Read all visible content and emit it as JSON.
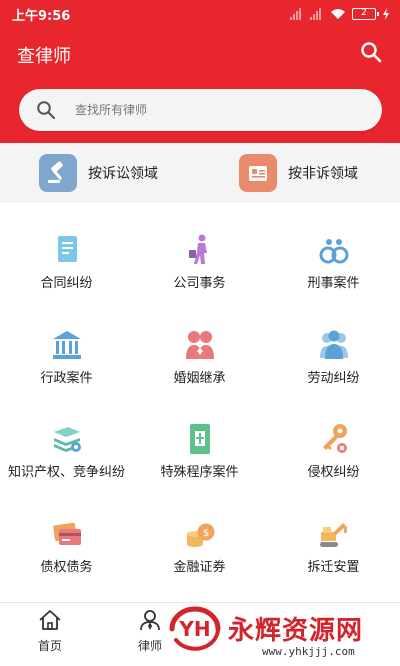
{
  "status_bar": {
    "time": "上午9:56",
    "battery": "2"
  },
  "header": {
    "title": "查律师"
  },
  "search": {
    "placeholder": "查找所有律师"
  },
  "domains": [
    {
      "label": "按诉讼领域",
      "icon": "gavel-icon"
    },
    {
      "label": "按非诉领域",
      "icon": "document-icon"
    }
  ],
  "categories": [
    {
      "label": "合同纠纷",
      "icon": "contract-icon"
    },
    {
      "label": "公司事务",
      "icon": "business-walker-icon"
    },
    {
      "label": "刑事案件",
      "icon": "handcuffs-icon"
    },
    {
      "label": "行政案件",
      "icon": "government-building-icon"
    },
    {
      "label": "婚姻继承",
      "icon": "couple-icon"
    },
    {
      "label": "劳动纠纷",
      "icon": "workers-icon"
    },
    {
      "label": "知识产权、竞争纠纷",
      "icon": "books-icon"
    },
    {
      "label": "特殊程序案件",
      "icon": "special-file-icon"
    },
    {
      "label": "侵权纠纷",
      "icon": "key-icon"
    },
    {
      "label": "债权债务",
      "icon": "credit-card-icon"
    },
    {
      "label": "金融证券",
      "icon": "coins-icon"
    },
    {
      "label": "拆迁安置",
      "icon": "excavator-icon"
    }
  ],
  "tabs": [
    {
      "label": "首页",
      "icon": "home-icon"
    },
    {
      "label": "律师",
      "icon": "lawyer-icon"
    }
  ],
  "watermark": {
    "logo_text": "YH",
    "text": "永辉资源网",
    "url": "www.yhkjjj.com"
  },
  "colors": {
    "brand": "#e8262d",
    "icon_blue": "#5aa2d8",
    "icon_pink": "#e9797a",
    "icon_orange": "#f0a35a",
    "icon_green": "#5cc18a"
  }
}
